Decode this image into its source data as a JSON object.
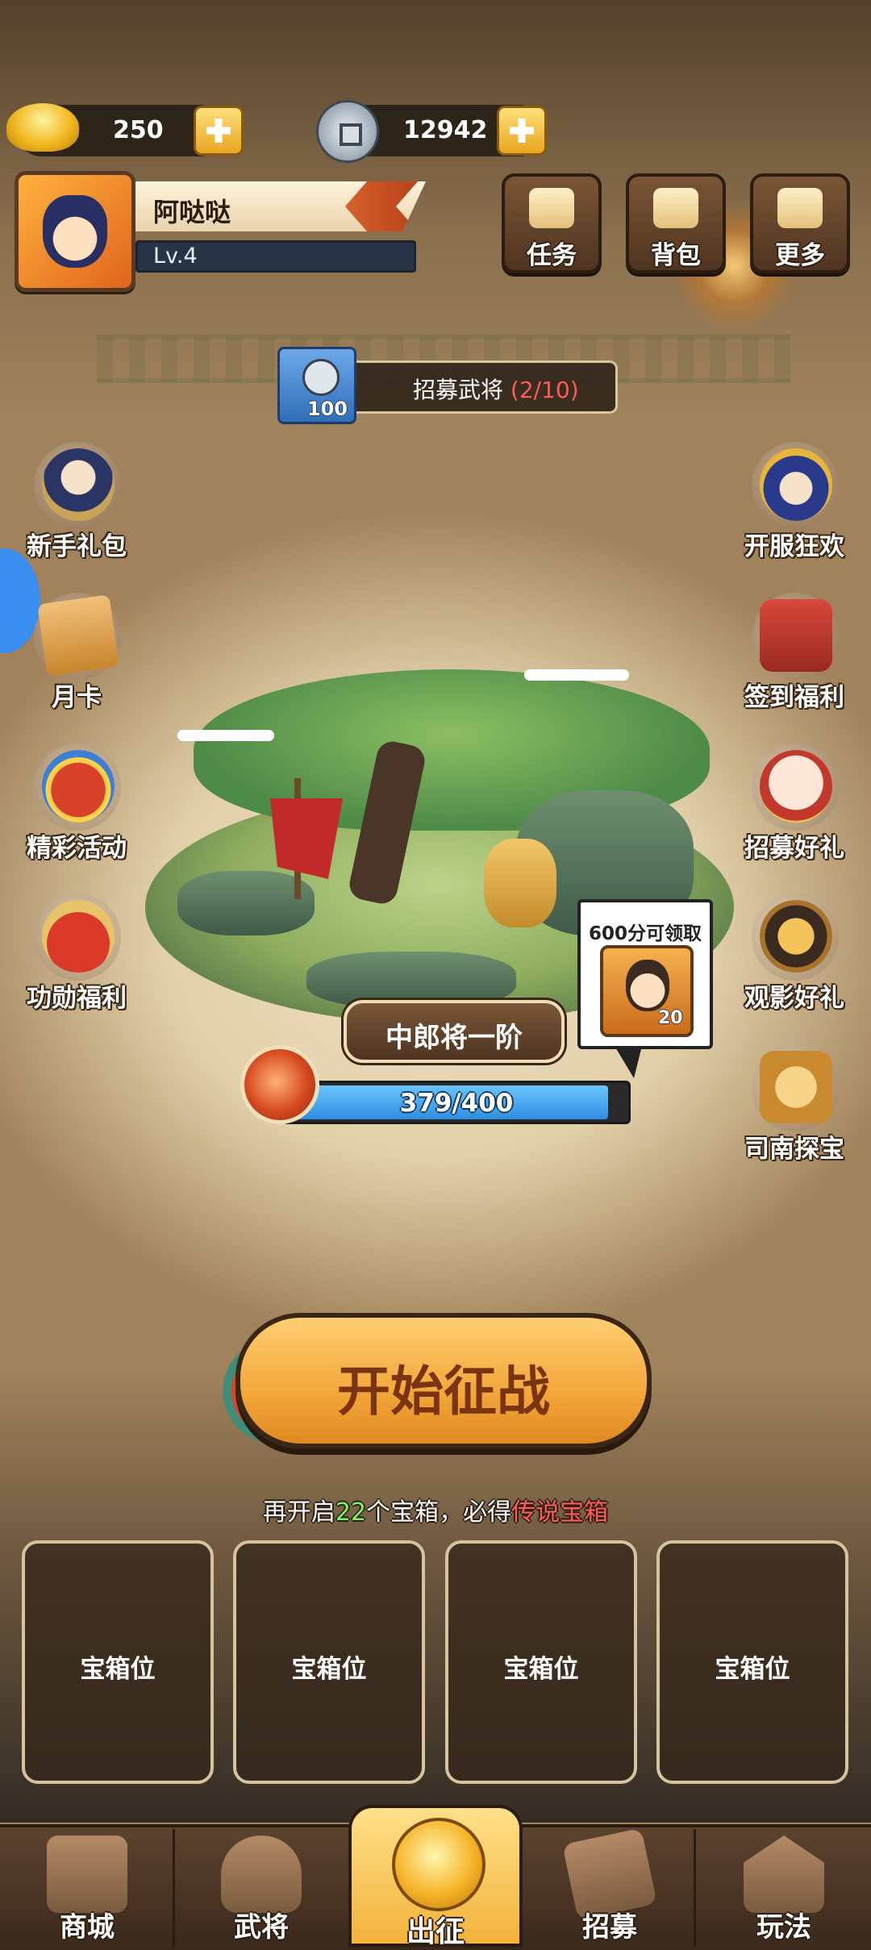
{
  "currency": {
    "gold_ingot": "250",
    "copper_coin": "12942"
  },
  "player": {
    "name": "阿哒哒",
    "level": "Lv.4"
  },
  "top_buttons": [
    {
      "label": "任务",
      "icon": "scroll-icon"
    },
    {
      "label": "背包",
      "icon": "bag-icon"
    },
    {
      "label": "更多",
      "icon": "menu-icon"
    }
  ],
  "recruit": {
    "cost": "100",
    "label": "招募武将",
    "progress": "(2/10)"
  },
  "left_side": [
    {
      "label": "新手礼包",
      "icon": "newbie-gift-icon"
    },
    {
      "label": "月卡",
      "icon": "month-card-icon"
    },
    {
      "label": "精彩活动",
      "icon": "events-icon"
    },
    {
      "label": "功勋福利",
      "icon": "merit-benefits-icon"
    }
  ],
  "right_side": [
    {
      "label": "开服狂欢",
      "icon": "server-carnival-icon"
    },
    {
      "label": "签到福利",
      "icon": "sign-in-icon"
    },
    {
      "label": "招募好礼",
      "icon": "recruit-gift-icon"
    },
    {
      "label": "观影好礼",
      "icon": "video-gift-icon"
    },
    {
      "label": "司南探宝",
      "icon": "compass-treasure-icon"
    }
  ],
  "reward_tooltip": {
    "text": "600分可领取",
    "count": "20"
  },
  "rank": {
    "title": "中郎将一阶",
    "progress_text": "379/400",
    "progress_fraction": 0.9475
  },
  "start_button": "开始征战",
  "chest_hint": {
    "prefix": "再开启",
    "count": "22",
    "middle": "个宝箱，必得",
    "reward": "传说宝箱"
  },
  "chest_slots": [
    "宝箱位",
    "宝箱位",
    "宝箱位",
    "宝箱位"
  ],
  "bottom_nav": [
    {
      "label": "商城",
      "icon": "shop-icon"
    },
    {
      "label": "武将",
      "icon": "general-helmet-icon"
    },
    {
      "label": "出征",
      "icon": "battle-icon",
      "active": true
    },
    {
      "label": "招募",
      "icon": "recruit-scroll-icon"
    },
    {
      "label": "玩法",
      "icon": "pavilion-icon"
    }
  ],
  "colors": {
    "accent_gold": "#f3b23a",
    "progress_blue": "#2e8fe0",
    "highlight_red": "#ff5a5a",
    "highlight_green": "#7cf55b"
  }
}
